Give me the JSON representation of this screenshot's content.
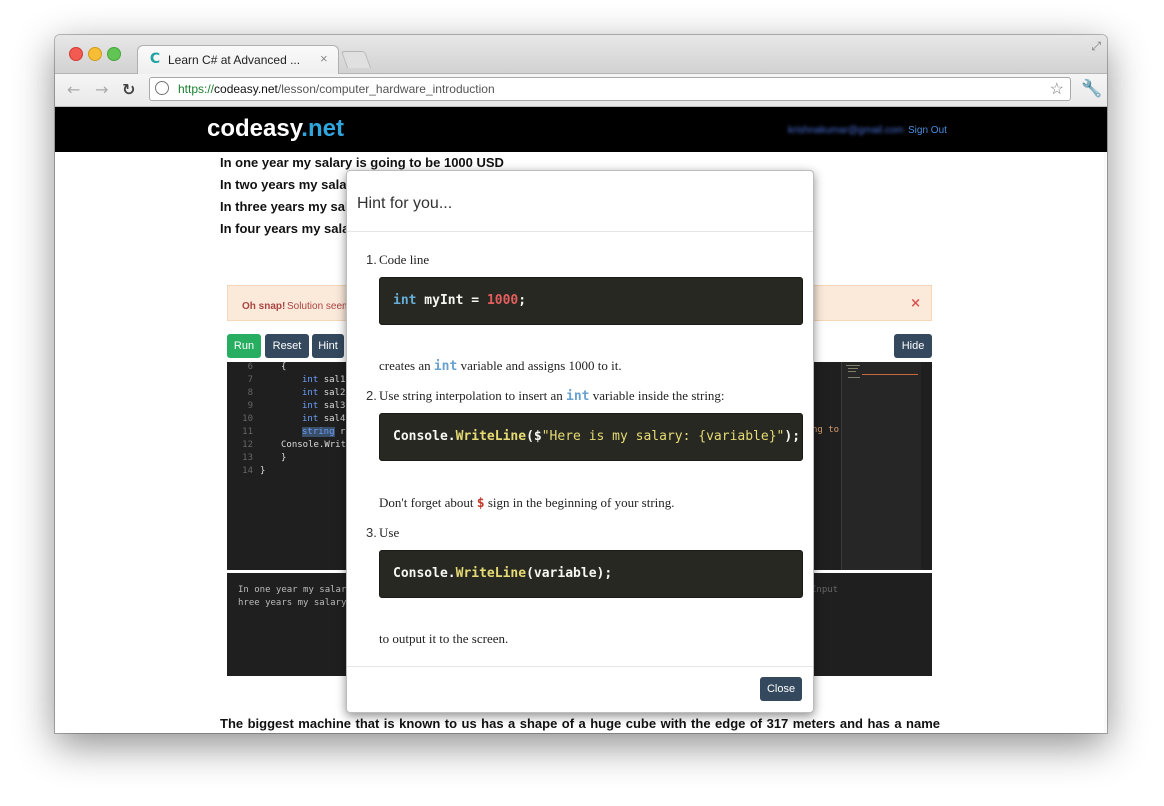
{
  "browser": {
    "tab_title": "Learn C# at Advanced ...",
    "tab_close": "×",
    "tab_icon": "C",
    "url_scheme": "https://",
    "url_host": "codeasy.net",
    "url_path": "/lesson/computer_hardware_introduction"
  },
  "site": {
    "logo_main": "codeasy",
    "logo_suffix": ".net",
    "user_email": "krishnakumar@gmail.com",
    "signout_label": "Sign Out",
    "accent_color": "#2fa6de"
  },
  "lesson": {
    "lines": [
      "In one year my salary is going to be 1000 USD",
      "In two years my salary",
      "In three years my sala",
      "In four years my salary"
    ],
    "paragraph": "The biggest machine that is known to us has a shape of a huge cube with the edge of 317 meters and has a name"
  },
  "alert": {
    "strong": "Oh snap!",
    "text": "Solution seem",
    "close": "×"
  },
  "editor_buttons": {
    "run": "Run",
    "reset": "Reset",
    "hint": "Hint",
    "hide": "Hide"
  },
  "editor": {
    "line_numbers": [
      "6",
      "7",
      "8",
      "9",
      "10",
      "11",
      "12",
      "13",
      "14"
    ],
    "code": {
      "l6": "{",
      "l7": "sal1",
      "l8": "sal2",
      "l9": "sal3",
      "l10": "sal4",
      "l11": "r",
      "l12": "Console.Writ",
      "l13": "}",
      "l14": "}",
      "kw_int": "int",
      "kw_string": "string"
    },
    "right_fragment": "ng to"
  },
  "output": {
    "lines": [
      "In one year my salary",
      "hree years my salary"
    ],
    "input_label": "Input"
  },
  "modal": {
    "title": "Hint for you...",
    "items": [
      {
        "number": "1.",
        "heading": "Code line",
        "code": {
          "kw": "int",
          "name": " myInt = ",
          "num": "1000",
          "end": ";"
        },
        "after_pre": "creates an ",
        "after_kw": "int",
        "after_post": " variable and assigns 1000 to it."
      },
      {
        "number": "2.",
        "heading_pre": "Use string interpolation to insert an ",
        "heading_kw": "int",
        "heading_post": " variable inside the string:",
        "code": {
          "cls": "Console.",
          "method": "WriteLine",
          "open": "($",
          "str": "\"Here is my salary: {variable}\"",
          "close": ");"
        },
        "after_pre": "Don't forget about ",
        "after_kw": "$",
        "after_post": " sign in the beginning of your string."
      },
      {
        "number": "3.",
        "heading": "Use",
        "code": {
          "cls": "Console.",
          "method": "WriteLine",
          "args": "(variable);"
        },
        "after": "to output it to the screen."
      }
    ],
    "close_label": "Close"
  }
}
